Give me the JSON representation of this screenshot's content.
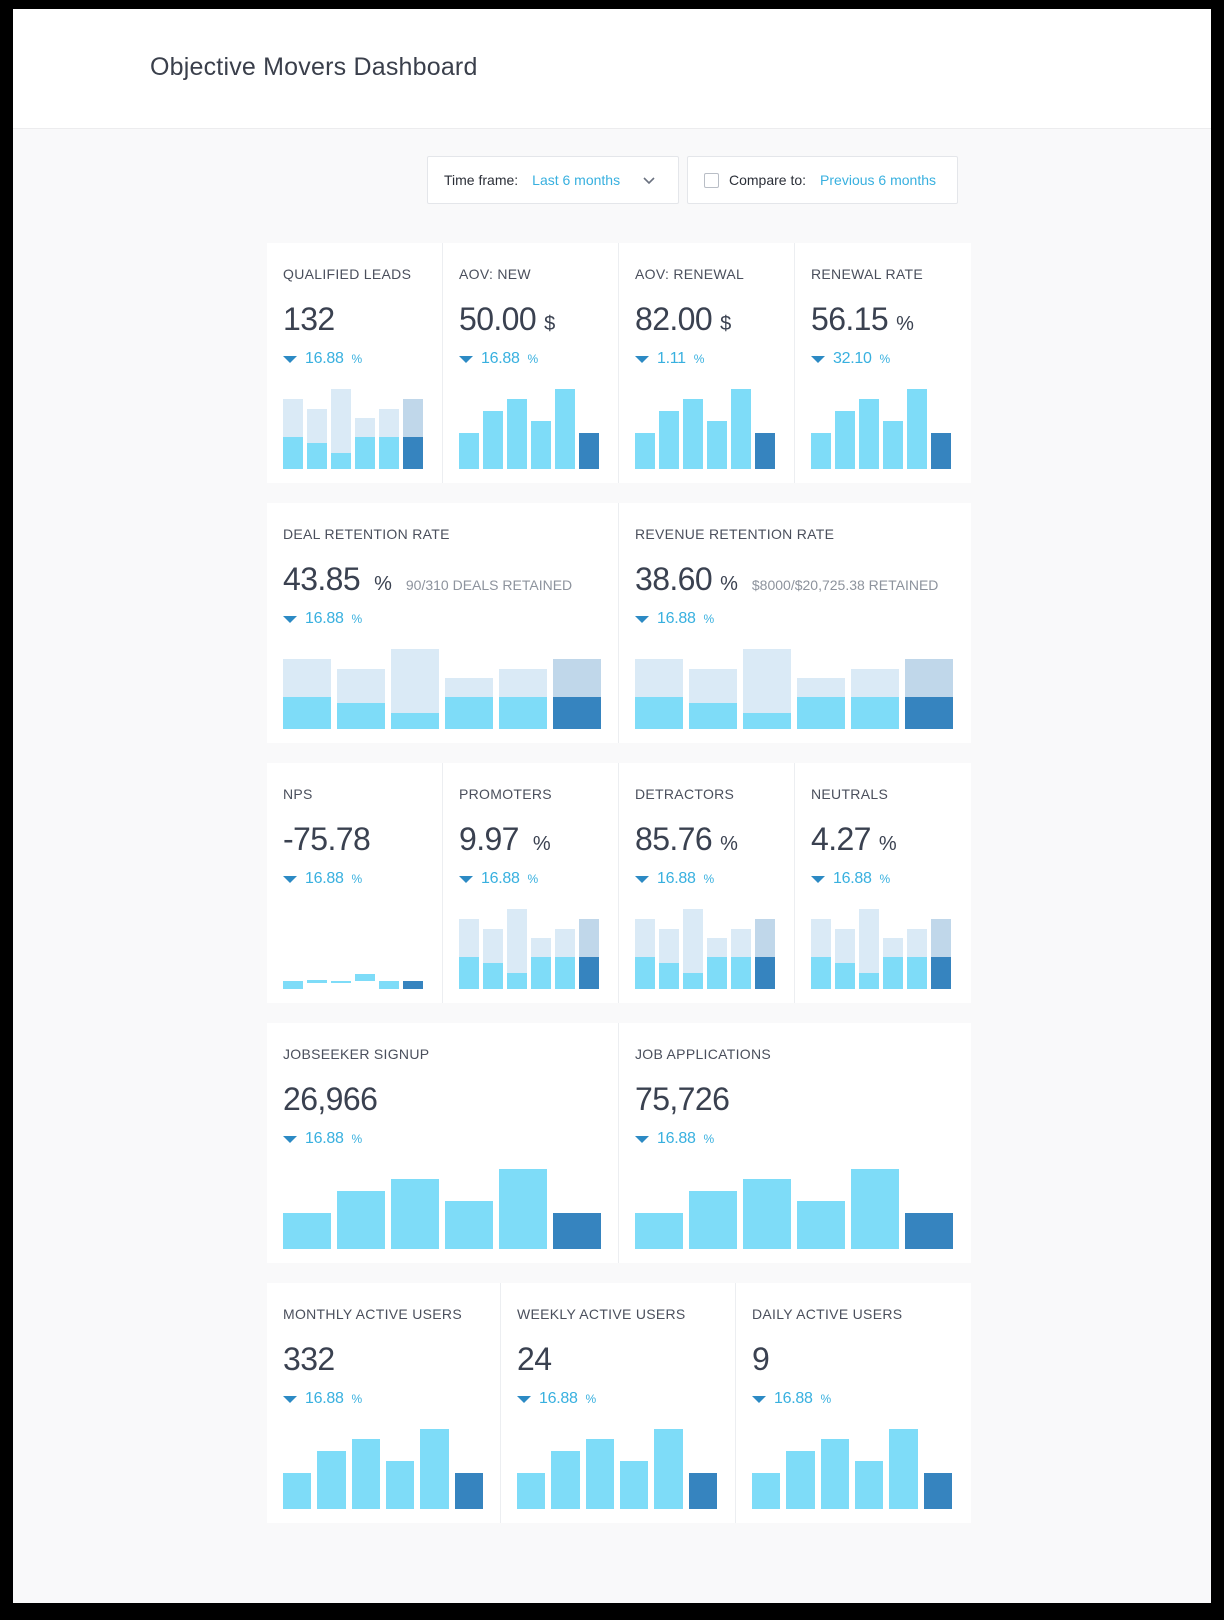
{
  "page": {
    "title": "Objective Movers Dashboard"
  },
  "filters": {
    "timeframe_label": "Time frame:",
    "timeframe_value": "Last 6 months",
    "compare_label": "Compare to:",
    "compare_value": "Previous 6 months",
    "compare_checked": false
  },
  "colors": {
    "accent": "#38b0df",
    "bar_current": "#7edcf8",
    "bar_latest": "#3684bf",
    "bar_previous": "#daeaf6",
    "bar_previous_latest": "#c0d7ea",
    "delta_arrow": "#2c8ac4"
  },
  "icons": {
    "delta": "triangle-down-icon",
    "dropdown": "chevron-down-icon"
  },
  "cards": {
    "qualified_leads": {
      "title": "QUALIFIED LEADS",
      "value": "132",
      "unit": "",
      "delta": "16.88",
      "delta_unit": "%"
    },
    "aov_new": {
      "title": "AOV: NEW",
      "value": "50.00",
      "unit": "$",
      "delta": "16.88",
      "delta_unit": "%"
    },
    "aov_renewal": {
      "title": "AOV: RENEWAL",
      "value": "82.00",
      "unit": "$",
      "delta": "1.11",
      "delta_unit": "%"
    },
    "renewal_rate": {
      "title": "RENEWAL RATE",
      "value": "56.15",
      "unit": "%",
      "delta": "32.10",
      "delta_unit": "%"
    },
    "deal_retention": {
      "title": "DEAL RETENTION RATE",
      "value": "43.85",
      "unit": "%",
      "note": "90/310 DEALS RETAINED",
      "delta": "16.88",
      "delta_unit": "%"
    },
    "revenue_retention": {
      "title": "REVENUE RETENTION RATE",
      "value": "38.60",
      "unit": "%",
      "note": "$8000/$20,725.38 RETAINED",
      "delta": "16.88",
      "delta_unit": "%"
    },
    "nps": {
      "title": "NPS",
      "value": "-75.78",
      "unit": "",
      "delta": "16.88",
      "delta_unit": "%"
    },
    "promoters": {
      "title": "PROMOTERS",
      "value": "9.97",
      "unit": "%",
      "delta": "16.88",
      "delta_unit": "%"
    },
    "detractors": {
      "title": "DETRACTORS",
      "value": "85.76",
      "unit": "%",
      "delta": "16.88",
      "delta_unit": "%"
    },
    "neutrals": {
      "title": "NEUTRALS",
      "value": "4.27",
      "unit": "%",
      "delta": "16.88",
      "delta_unit": "%"
    },
    "jobseeker_signup": {
      "title": "JOBSEEKER SIGNUP",
      "value": "26,966",
      "unit": "",
      "delta": "16.88",
      "delta_unit": "%"
    },
    "job_applications": {
      "title": "JOB APPLICATIONS",
      "value": "75,726",
      "unit": "",
      "delta": "16.88",
      "delta_unit": "%"
    },
    "mau": {
      "title": "MONTHLY ACTIVE USERS",
      "value": "332",
      "unit": "",
      "delta": "16.88",
      "delta_unit": "%"
    },
    "wau": {
      "title": "WEEKLY ACTIVE USERS",
      "value": "24",
      "unit": "",
      "delta": "16.88",
      "delta_unit": "%"
    },
    "dau": {
      "title": "DAILY ACTIVE USERS",
      "value": "9",
      "unit": "",
      "delta": "16.88",
      "delta_unit": "%"
    }
  },
  "sparklines": {
    "growth": {
      "current": [
        45,
        73,
        87,
        60,
        100,
        45
      ]
    },
    "comparison": {
      "current": [
        40,
        32,
        20,
        40,
        40,
        40
      ],
      "previous": [
        87,
        75,
        100,
        64,
        75,
        87
      ]
    },
    "nps": {
      "current": [
        20,
        8,
        4,
        17,
        20,
        20
      ],
      "offset": [
        0,
        15,
        16,
        21,
        0,
        0
      ]
    }
  }
}
